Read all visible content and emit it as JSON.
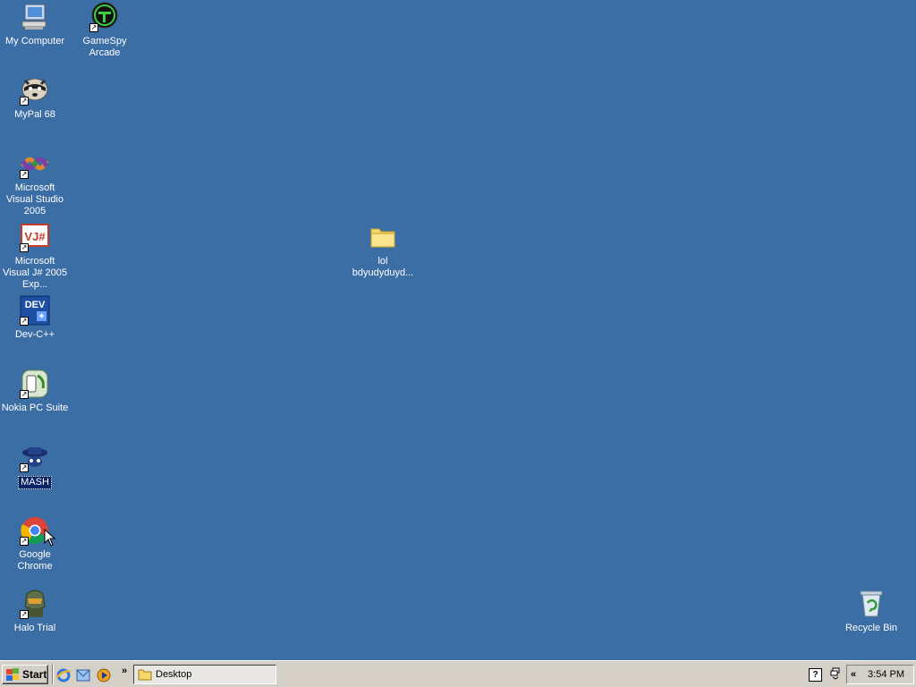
{
  "desktop": {
    "icons": [
      {
        "id": "my-computer",
        "label": "My Computer",
        "icon": "computer-icon",
        "shortcut": false
      },
      {
        "id": "gamespy",
        "label": "GameSpy Arcade",
        "icon": "gamespy-icon",
        "shortcut": true
      },
      {
        "id": "mypal",
        "label": "MyPal 68",
        "icon": "raccoon-icon",
        "shortcut": true
      },
      {
        "id": "msvs",
        "label": "Microsoft Visual Studio 2005",
        "icon": "visual-studio-icon",
        "shortcut": true
      },
      {
        "id": "msvj",
        "label": "Microsoft Visual J# 2005 Exp...",
        "icon": "vj-icon",
        "shortcut": true
      },
      {
        "id": "devcpp",
        "label": "Dev-C++",
        "icon": "dev-cpp-icon",
        "shortcut": true
      },
      {
        "id": "nokia",
        "label": "Nokia PC Suite",
        "icon": "nokia-icon",
        "shortcut": true
      },
      {
        "id": "mash",
        "label": "MASH",
        "icon": "mash-icon",
        "shortcut": true
      },
      {
        "id": "chrome",
        "label": "Google Chrome",
        "icon": "chrome-icon",
        "shortcut": true
      },
      {
        "id": "halo",
        "label": "Halo Trial",
        "icon": "halo-icon",
        "shortcut": true
      },
      {
        "id": "folder",
        "label": "lol bdyudyduyd...",
        "icon": "folder-icon",
        "shortcut": false
      },
      {
        "id": "recycle",
        "label": "Recycle Bin",
        "icon": "recycle-bin-icon",
        "shortcut": false
      }
    ],
    "dev_icon_text": "DEV",
    "vj_icon_text": "VJ#"
  },
  "taskbar": {
    "start_label": "Start",
    "quick_launch_more": "»",
    "task_button_label": "Desktop",
    "tray_expand": "«",
    "help_glyph": "?",
    "clock": "3:54 PM"
  },
  "colors": {
    "desktop": "#3a6ea5",
    "taskbar": "#d4d0c8",
    "selection": "#0a246a"
  }
}
